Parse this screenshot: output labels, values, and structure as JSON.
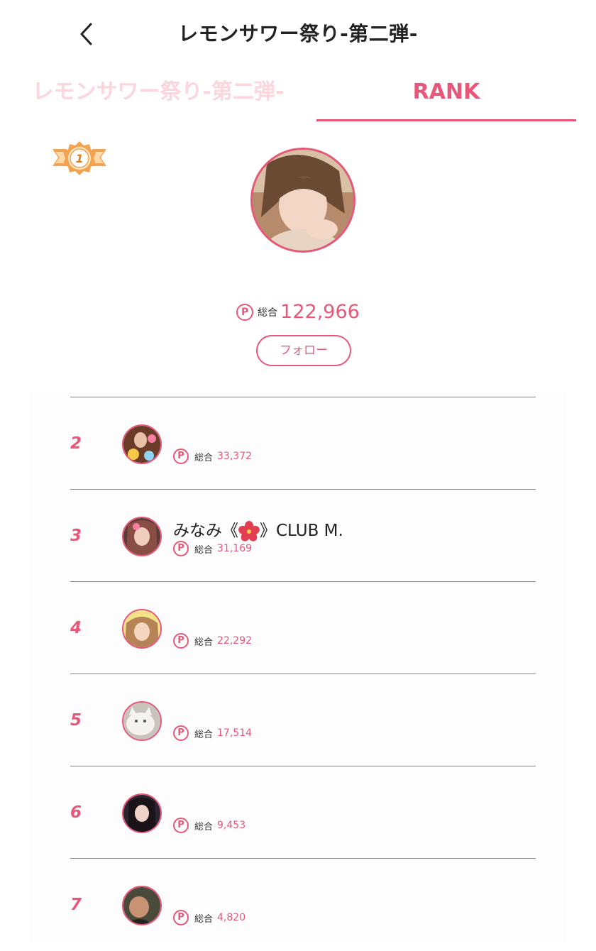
{
  "header": {
    "title": "レモンサワー祭り-第二弾-",
    "back_icon": "chevron-left-icon"
  },
  "tabs": [
    {
      "label": "レモンサワー祭り-第二弾-",
      "active": false
    },
    {
      "label": "RANK",
      "active": true
    }
  ],
  "top_rank": {
    "medal_number": "1",
    "total_label": "総合",
    "total_value": "122,966",
    "follow_label": "フォロー"
  },
  "ranking": [
    {
      "rank": "2",
      "name": "",
      "total_label": "総合",
      "total_value": "33,372"
    },
    {
      "rank": "3",
      "name_prefix": "みなみ《",
      "name_suffix": "》CLUB M.",
      "name_icon": "hibiscus-flower-icon",
      "total_label": "総合",
      "total_value": "31,169"
    },
    {
      "rank": "4",
      "name": "",
      "total_label": "総合",
      "total_value": "22,292"
    },
    {
      "rank": "5",
      "name": "",
      "total_label": "総合",
      "total_value": "17,514"
    },
    {
      "rank": "6",
      "name": "",
      "total_label": "総合",
      "total_value": "9,453"
    },
    {
      "rank": "7",
      "name": "",
      "total_label": "総合",
      "total_value": "4,820"
    }
  ],
  "colors": {
    "accent": "#e8577a",
    "inactive_tab": "#fbd6dc",
    "medal": "#f3a350"
  },
  "points_icon_letter": "P"
}
